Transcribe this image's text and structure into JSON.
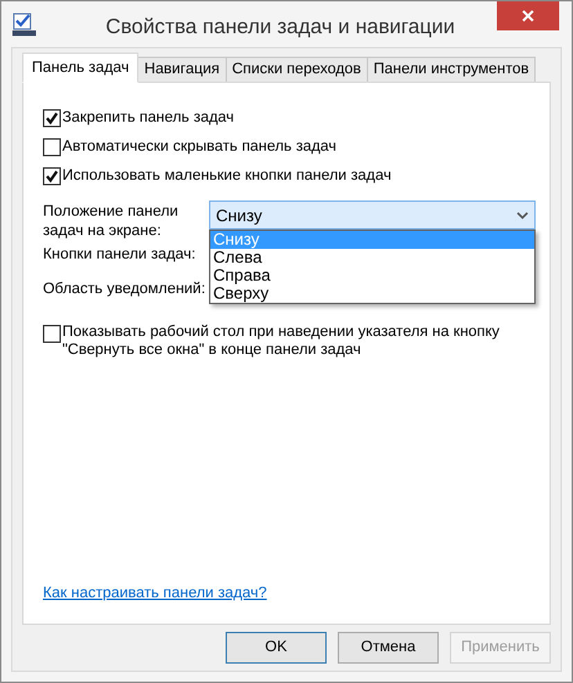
{
  "window": {
    "title": "Свойства панели задач и навигации"
  },
  "tabs": [
    {
      "label": "Панель задач",
      "selected": true
    },
    {
      "label": "Навигация",
      "selected": false
    },
    {
      "label": "Списки переходов",
      "selected": false
    },
    {
      "label": "Панели инструментов",
      "selected": false
    }
  ],
  "options": [
    {
      "label": "Закрепить панель задач",
      "checked": true
    },
    {
      "label": "Автоматически скрывать панель задач",
      "checked": false
    },
    {
      "label": "Использовать маленькие кнопки панели задач",
      "checked": true
    }
  ],
  "position": {
    "label": "Положение панели задач на экране:",
    "value": "Снизу",
    "expanded": true,
    "options": [
      {
        "label": "Снизу",
        "selected": true
      },
      {
        "label": "Слева",
        "selected": false
      },
      {
        "label": "Справа",
        "selected": false
      },
      {
        "label": "Сверху",
        "selected": false
      }
    ]
  },
  "fields": [
    {
      "label": "Кнопки панели задач:"
    },
    {
      "label": "Область уведомлений:"
    }
  ],
  "peek": {
    "label": "Показывать рабочий стол при наведении указателя на кнопку \"Свернуть все окна\" в конце панели задач",
    "checked": false
  },
  "help_link": "Как настраивать панели задач?",
  "buttons": [
    {
      "label": "OK",
      "default": true,
      "disabled": false
    },
    {
      "label": "Отмена",
      "default": false,
      "disabled": false
    },
    {
      "label": "Применить",
      "default": false,
      "disabled": true
    }
  ]
}
